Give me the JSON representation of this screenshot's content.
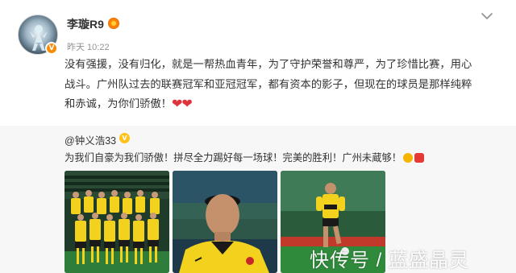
{
  "post": {
    "username": "李璇R9",
    "timestamp": "昨天 10:22",
    "text_lines": [
      "没有强援，没有归化，就是一帮热血青年，为了守护荣誉和尊严，为了珍惜比赛，用心",
      "战斗。广州队过去的联赛冠军和亚冠冠军，都有资本的影子，但现在的球员是那样纯粹",
      "和赤诚，为你们骄傲！"
    ],
    "hearts": "❤❤",
    "menu_icon": "chevron-down-icon",
    "verified_badge": "V"
  },
  "repost": {
    "author": "@钟义浩33",
    "verified_badge": "V",
    "text": "为我们自豪为我们骄傲！拼尽全力踢好每一场球！完美的胜利！广州未蔵够！",
    "emojis": [
      "clap-emoji",
      "fire-emoji"
    ],
    "images": [
      "team-photo",
      "player-portrait",
      "player-dribbling"
    ]
  },
  "watermark": "快传号 / 蓝盛晶灵",
  "colors": {
    "accent_orange": "#ff8200",
    "heart_red": "#e0323b",
    "repost_bg": "#f7f7f7",
    "jersey_yellow": "#f2d21c",
    "pitch_green": "#2f7d3a"
  }
}
